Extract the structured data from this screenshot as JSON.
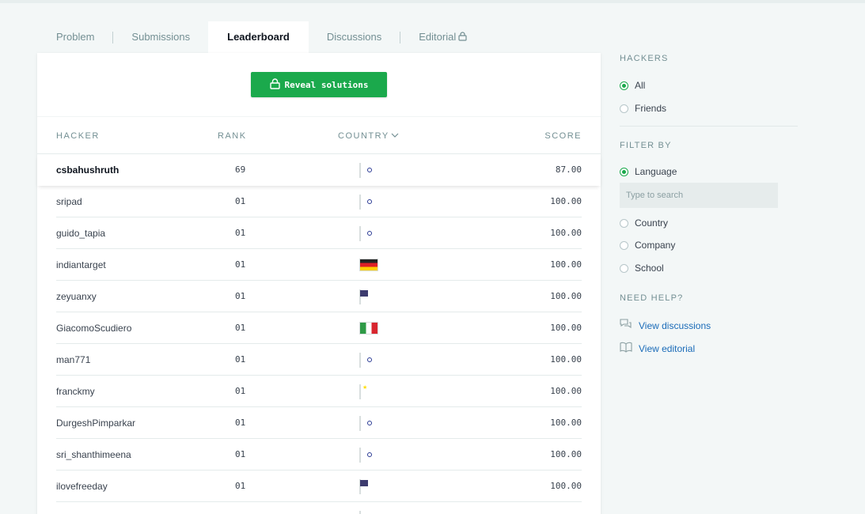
{
  "tabs": [
    {
      "label": "Problem"
    },
    {
      "label": "Submissions"
    },
    {
      "label": "Leaderboard"
    },
    {
      "label": "Discussions"
    },
    {
      "label": "Editorial"
    }
  ],
  "reveal_button": {
    "label": "Reveal solutions",
    "icon": "lock-icon"
  },
  "table": {
    "headers": {
      "hacker": "HACKER",
      "rank": "RANK",
      "country": "COUNTRY",
      "score": "SCORE"
    },
    "rows": [
      {
        "name": "csbahushruth",
        "rank": "69",
        "flag": "in",
        "score": "87.00"
      },
      {
        "name": "sripad",
        "rank": "01",
        "flag": "in",
        "score": "100.00"
      },
      {
        "name": "guido_tapia",
        "rank": "01",
        "flag": "in",
        "score": "100.00"
      },
      {
        "name": "indiantarget",
        "rank": "01",
        "flag": "de",
        "score": "100.00"
      },
      {
        "name": "zeyuanxy",
        "rank": "01",
        "flag": "us",
        "score": "100.00"
      },
      {
        "name": "GiacomoScudiero",
        "rank": "01",
        "flag": "it",
        "score": "100.00"
      },
      {
        "name": "man771",
        "rank": "01",
        "flag": "in",
        "score": "100.00"
      },
      {
        "name": "franckmy",
        "rank": "01",
        "flag": "cn",
        "score": "100.00"
      },
      {
        "name": "DurgeshPimparkar",
        "rank": "01",
        "flag": "in",
        "score": "100.00"
      },
      {
        "name": "sri_shanthimeena",
        "rank": "01",
        "flag": "in",
        "score": "100.00"
      },
      {
        "name": "ilovefreeday",
        "rank": "01",
        "flag": "us",
        "score": "100.00"
      },
      {
        "name": "",
        "rank": "",
        "flag": "in",
        "score": ""
      }
    ]
  },
  "sidebar": {
    "hackers_heading": "HACKERS",
    "hackers_options": [
      {
        "label": "All",
        "selected": true
      },
      {
        "label": "Friends",
        "selected": false
      }
    ],
    "filter_heading": "FILTER BY",
    "filter_options": [
      {
        "label": "Language",
        "selected": true
      },
      {
        "label": "Country",
        "selected": false
      },
      {
        "label": "Company",
        "selected": false
      },
      {
        "label": "School",
        "selected": false
      }
    ],
    "search_placeholder": "Type to search",
    "help_heading": "NEED HELP?",
    "help_links": [
      {
        "label": "View discussions",
        "icon": "chat-icon"
      },
      {
        "label": "View editorial",
        "icon": "book-icon"
      }
    ]
  },
  "colors": {
    "accent": "#1ba94c",
    "link": "#1a6bb8",
    "muted": "#738f93"
  }
}
